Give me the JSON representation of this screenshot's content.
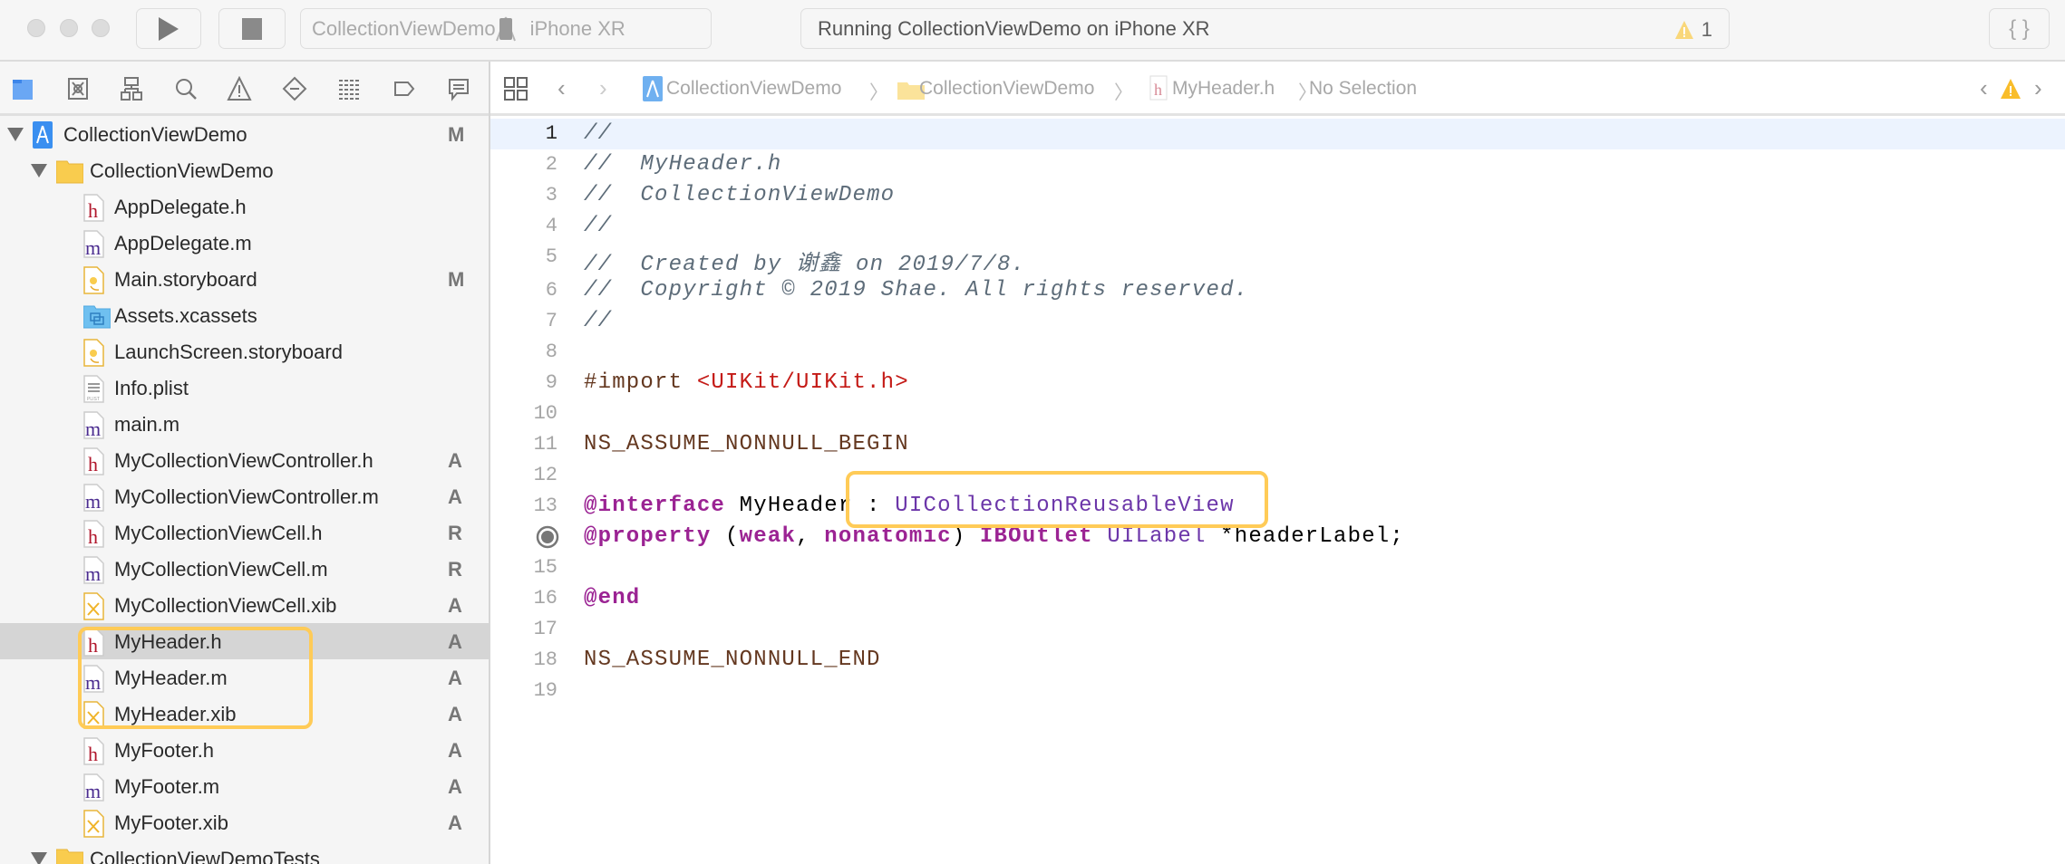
{
  "toolbar": {
    "scheme_target": "CollectionViewDemo",
    "scheme_device": "iPhone XR",
    "activity_text": "Running CollectionViewDemo on iPhone XR",
    "warning_count": "1",
    "braces_label": "{ }"
  },
  "navigator_tabs": [
    "project-navigator",
    "source-control-navigator",
    "symbol-navigator",
    "find-navigator",
    "issue-navigator",
    "test-navigator",
    "debug-navigator",
    "breakpoint-navigator",
    "report-navigator"
  ],
  "sidebar": {
    "items": [
      {
        "label": "CollectionViewDemo",
        "icon": "project",
        "level": 0,
        "expanded": true,
        "badge": "M"
      },
      {
        "label": "CollectionViewDemo",
        "icon": "folder",
        "level": 1,
        "expanded": true,
        "badge": ""
      },
      {
        "label": "AppDelegate.h",
        "icon": "h",
        "level": 2,
        "badge": ""
      },
      {
        "label": "AppDelegate.m",
        "icon": "m",
        "level": 2,
        "badge": ""
      },
      {
        "label": "Main.storyboard",
        "icon": "storyboard",
        "level": 2,
        "badge": "M"
      },
      {
        "label": "Assets.xcassets",
        "icon": "assets",
        "level": 2,
        "badge": ""
      },
      {
        "label": "LaunchScreen.storyboard",
        "icon": "storyboard",
        "level": 2,
        "badge": ""
      },
      {
        "label": "Info.plist",
        "icon": "plist",
        "level": 2,
        "badge": ""
      },
      {
        "label": "main.m",
        "icon": "m",
        "level": 2,
        "badge": ""
      },
      {
        "label": "MyCollectionViewController.h",
        "icon": "h",
        "level": 2,
        "badge": "A"
      },
      {
        "label": "MyCollectionViewController.m",
        "icon": "m",
        "level": 2,
        "badge": "A"
      },
      {
        "label": "MyCollectionViewCell.h",
        "icon": "h",
        "level": 2,
        "badge": "R"
      },
      {
        "label": "MyCollectionViewCell.m",
        "icon": "m",
        "level": 2,
        "badge": "R"
      },
      {
        "label": "MyCollectionViewCell.xib",
        "icon": "xib",
        "level": 2,
        "badge": "A"
      },
      {
        "label": "MyHeader.h",
        "icon": "h",
        "level": 2,
        "badge": "A",
        "selected": true
      },
      {
        "label": "MyHeader.m",
        "icon": "m",
        "level": 2,
        "badge": "A"
      },
      {
        "label": "MyHeader.xib",
        "icon": "xib",
        "level": 2,
        "badge": "A"
      },
      {
        "label": "MyFooter.h",
        "icon": "h",
        "level": 2,
        "badge": "A"
      },
      {
        "label": "MyFooter.m",
        "icon": "m",
        "level": 2,
        "badge": "A"
      },
      {
        "label": "MyFooter.xib",
        "icon": "xib",
        "level": 2,
        "badge": "A"
      },
      {
        "label": "CollectionViewDemoTests",
        "icon": "folder",
        "level": 1,
        "expanded": true,
        "badge": ""
      }
    ]
  },
  "jumpbar": {
    "crumbs": [
      "CollectionViewDemo",
      "CollectionViewDemo",
      "MyHeader.h",
      "No Selection"
    ]
  },
  "editor": {
    "current_line": 1,
    "breakpoint_line": 14,
    "lines": [
      [
        {
          "t": "//",
          "c": "comment"
        }
      ],
      [
        {
          "t": "//  MyHeader.h",
          "c": "comment"
        }
      ],
      [
        {
          "t": "//  CollectionViewDemo",
          "c": "comment"
        }
      ],
      [
        {
          "t": "//",
          "c": "comment"
        }
      ],
      [
        {
          "t": "//  Created by 谢鑫 on 2019/7/8.",
          "c": "comment"
        }
      ],
      [
        {
          "t": "//  Copyright © 2019 Shae. All rights reserved.",
          "c": "comment"
        }
      ],
      [
        {
          "t": "//",
          "c": "comment"
        }
      ],
      [],
      [
        {
          "t": "#import ",
          "c": "pre"
        },
        {
          "t": "<UIKit/UIKit.h>",
          "c": "str"
        }
      ],
      [],
      [
        {
          "t": "NS_ASSUME_NONNULL_BEGIN",
          "c": "pre"
        }
      ],
      [],
      [
        {
          "t": "@interface",
          "c": "kw"
        },
        {
          "t": " MyHeader : ",
          "c": "plain"
        },
        {
          "t": "UICollectionReusableView",
          "c": "type"
        }
      ],
      [
        {
          "t": "@property",
          "c": "kw"
        },
        {
          "t": " (",
          "c": "plain"
        },
        {
          "t": "weak",
          "c": "kw"
        },
        {
          "t": ", ",
          "c": "plain"
        },
        {
          "t": "nonatomic",
          "c": "kw"
        },
        {
          "t": ") ",
          "c": "plain"
        },
        {
          "t": "IBOutlet",
          "c": "kw"
        },
        {
          "t": " ",
          "c": "plain"
        },
        {
          "t": "UILabel",
          "c": "type"
        },
        {
          "t": " *headerLabel;",
          "c": "plain"
        }
      ],
      [],
      [
        {
          "t": "@end",
          "c": "kw"
        }
      ],
      [],
      [
        {
          "t": "NS_ASSUME_NONNULL_END",
          "c": "pre"
        }
      ],
      []
    ]
  },
  "colors": {
    "highlight_box": "#ffcb57",
    "current_line": "#ecf3fe",
    "warning": "#f9bd2a"
  }
}
